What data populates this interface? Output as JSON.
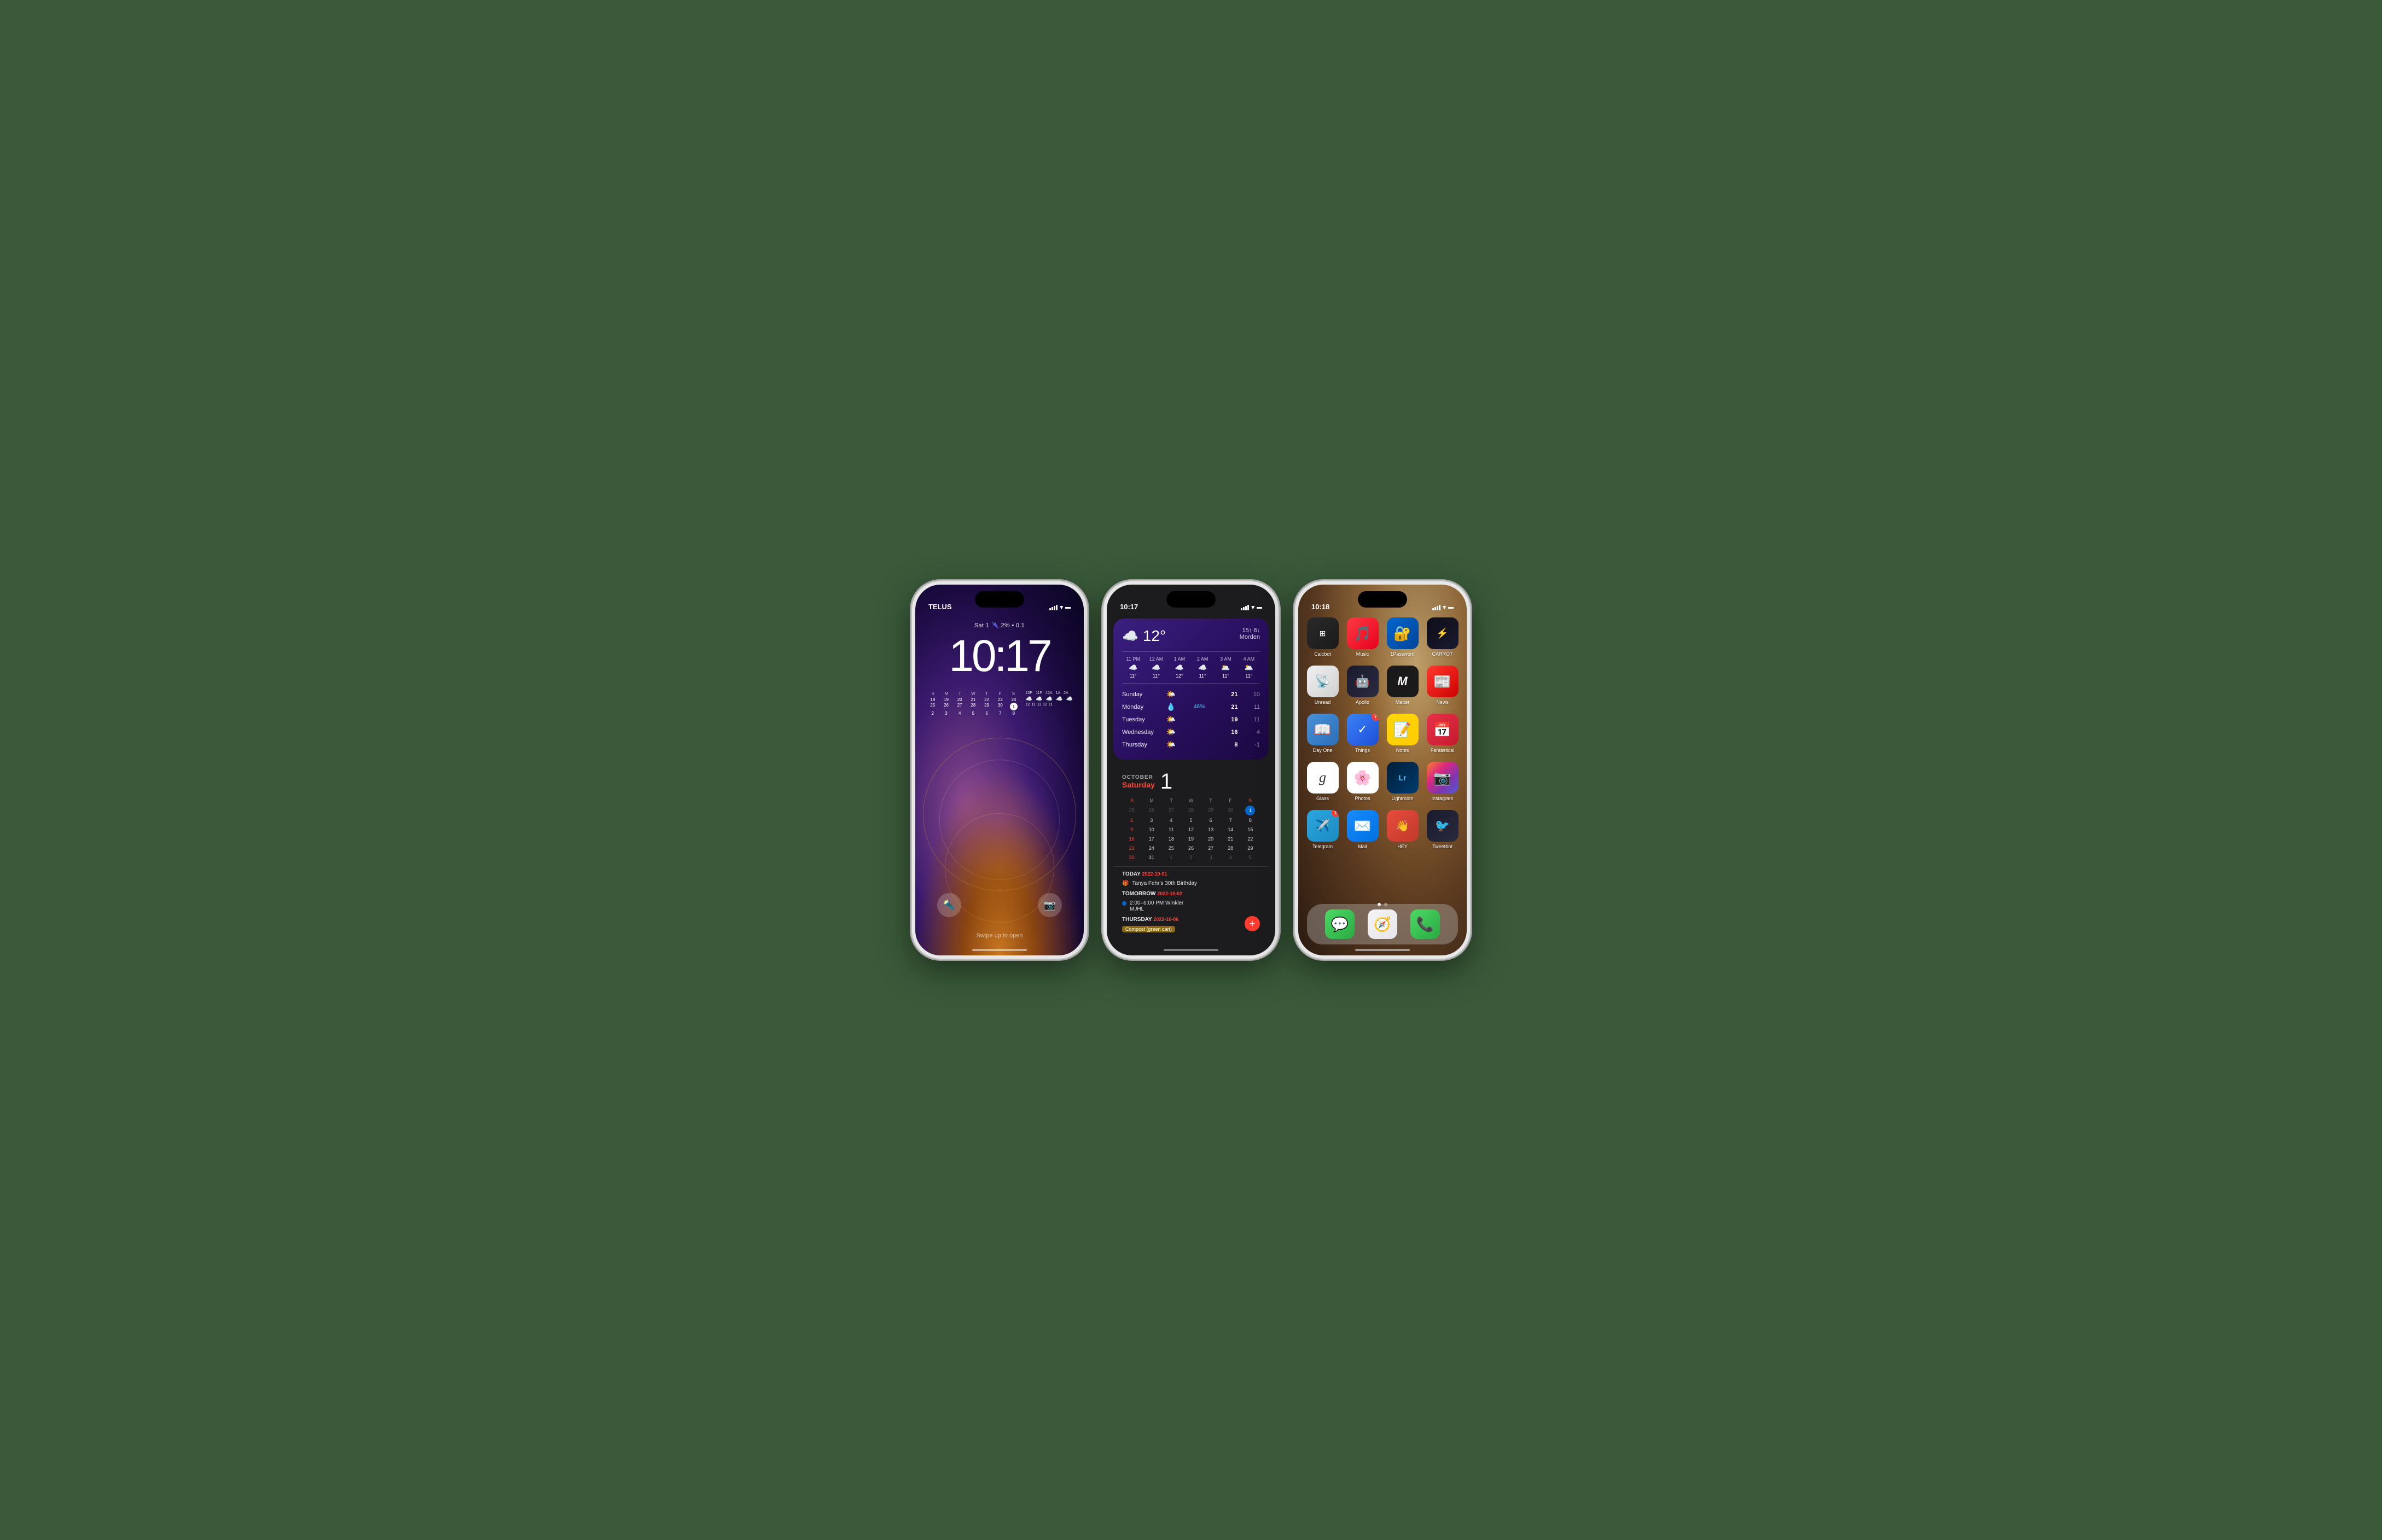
{
  "phones": {
    "phone1": {
      "type": "lock_screen",
      "carrier": "TELUS",
      "time": "10:17",
      "date": "Sat 1",
      "weather_summary": "🌂 2% • 0.1",
      "calendar": {
        "headers": [
          "S",
          "M",
          "T",
          "W",
          "T",
          "F",
          "S"
        ],
        "rows": [
          [
            "18",
            "19",
            "20",
            "21",
            "22",
            "23",
            "24"
          ],
          [
            "25",
            "26",
            "27",
            "28",
            "29",
            "30",
            "1"
          ],
          [
            "2",
            "3",
            "4",
            "5",
            "6",
            "7",
            "8"
          ]
        ]
      },
      "hourly_times": [
        "10P",
        "11P",
        "12A",
        "1A",
        "2A"
      ],
      "hourly_temps": [
        "12",
        "11",
        "11",
        "12",
        "11"
      ],
      "swipe_text": "Swipe up to open"
    },
    "phone2": {
      "type": "widgets",
      "carrier": "",
      "time": "10:17",
      "weather_widget": {
        "temp": "12°",
        "location": "Morden",
        "high": "15↑",
        "low": "8↓",
        "hourly": [
          {
            "time": "11 PM",
            "icon": "☁️",
            "temp": "11°"
          },
          {
            "time": "12 AM",
            "icon": "☁️",
            "temp": "11°"
          },
          {
            "time": "1 AM",
            "icon": "☁️",
            "temp": "12°"
          },
          {
            "time": "2 AM",
            "icon": "☁️",
            "temp": "11°"
          },
          {
            "time": "3 AM",
            "icon": "🌥️",
            "temp": "11°"
          },
          {
            "time": "4 AM",
            "icon": "🌥️",
            "temp": "11°"
          }
        ],
        "forecast": [
          {
            "day": "Sunday",
            "icon": "🌤️",
            "pct": "",
            "hi": "21",
            "lo": "10"
          },
          {
            "day": "Monday",
            "icon": "💧",
            "pct": "46%",
            "hi": "21",
            "lo": "11"
          },
          {
            "day": "Tuesday",
            "icon": "🌤️",
            "pct": "",
            "hi": "19",
            "lo": "11"
          },
          {
            "day": "Wednesday",
            "icon": "🌤️",
            "pct": "",
            "hi": "16",
            "lo": "4"
          },
          {
            "day": "Thursday",
            "icon": "🌤️",
            "pct": "",
            "hi": "8",
            "lo": "-1"
          }
        ]
      },
      "calendar_widget": {
        "month": "OCTOBER",
        "day_of_week": "Saturday",
        "today_num": "1",
        "headers": [
          "S",
          "M",
          "T",
          "W",
          "T",
          "F",
          "S"
        ],
        "weeks": [
          [
            "25",
            "26",
            "27",
            "28",
            "29",
            "30",
            "1"
          ],
          [
            "2",
            "3",
            "4",
            "5",
            "6",
            "7",
            "8"
          ],
          [
            "9",
            "10",
            "11",
            "12",
            "13",
            "14",
            "15"
          ],
          [
            "16",
            "17",
            "18",
            "19",
            "20",
            "21",
            "22"
          ],
          [
            "23",
            "24",
            "25",
            "26",
            "27",
            "28",
            "29"
          ],
          [
            "30",
            "31",
            "1",
            "2",
            "3",
            "4",
            "5"
          ]
        ],
        "events": [
          {
            "section": "TODAY",
            "date": "2022-10-01",
            "items": [
              {
                "icon": "🎁",
                "text": "Tanya Fehr's 30th Birthday"
              }
            ]
          },
          {
            "section": "TOMORROW",
            "date": "2022-10-02",
            "items": [
              {
                "type": "dot",
                "color": "#0066cc",
                "text": "2:00–6:00 PM Winkler"
              },
              {
                "type": "text",
                "text": "MJHL"
              }
            ]
          },
          {
            "section": "THURSDAY",
            "date": "2022-10-06",
            "items": [
              {
                "type": "tag",
                "color": "#8b6914",
                "text": "Compost (green cart)"
              }
            ]
          }
        ]
      }
    },
    "phone3": {
      "type": "home_screen",
      "carrier": "",
      "time": "10:18",
      "apps": [
        {
          "id": "calcbot",
          "label": "Calcbot",
          "icon_class": "icon-calcbot",
          "emoji": "⊞",
          "badge": null
        },
        {
          "id": "music",
          "label": "Music",
          "icon_class": "icon-music",
          "emoji": "🎵",
          "badge": null
        },
        {
          "id": "1password",
          "label": "1Password",
          "icon_class": "icon-1password",
          "emoji": "🔑",
          "badge": null
        },
        {
          "id": "carrot",
          "label": "CARROT",
          "icon_class": "icon-carrot",
          "emoji": "⚡",
          "badge": null
        },
        {
          "id": "unread",
          "label": "Unread",
          "icon_class": "icon-unread",
          "emoji": "📡",
          "badge": null
        },
        {
          "id": "apollo",
          "label": "Apollo",
          "icon_class": "icon-apollo",
          "emoji": "👾",
          "badge": null
        },
        {
          "id": "matter",
          "label": "Matter",
          "icon_class": "icon-matter",
          "emoji": "M",
          "badge": null
        },
        {
          "id": "news",
          "label": "News",
          "icon_class": "icon-news",
          "emoji": "📰",
          "badge": null
        },
        {
          "id": "dayone",
          "label": "Day One",
          "icon_class": "icon-dayone",
          "emoji": "📖",
          "badge": null
        },
        {
          "id": "things",
          "label": "Things",
          "icon_class": "icon-things",
          "emoji": "✓",
          "badge": "7"
        },
        {
          "id": "notes",
          "label": "Notes",
          "icon_class": "icon-notes",
          "emoji": "📝",
          "badge": null
        },
        {
          "id": "fantastical",
          "label": "Fantastical",
          "icon_class": "icon-fantastical",
          "emoji": "📅",
          "badge": null
        },
        {
          "id": "glass",
          "label": "Glass",
          "icon_class": "icon-glass",
          "emoji": "g",
          "badge": null
        },
        {
          "id": "photos",
          "label": "Photos",
          "icon_class": "icon-photos",
          "emoji": "🌸",
          "badge": null
        },
        {
          "id": "lightroom",
          "label": "Lightroom",
          "icon_class": "icon-lightroom",
          "emoji": "Lr",
          "badge": null
        },
        {
          "id": "instagram",
          "label": "Instagram",
          "icon_class": "icon-instagram",
          "emoji": "📷",
          "badge": null
        },
        {
          "id": "telegram",
          "label": "Telegram",
          "icon_class": "icon-telegram",
          "emoji": "✈️",
          "badge": "1"
        },
        {
          "id": "mail",
          "label": "Mail",
          "icon_class": "icon-mail",
          "emoji": "✉️",
          "badge": null
        },
        {
          "id": "hey",
          "label": "HEY",
          "icon_class": "icon-hey",
          "emoji": "👋",
          "badge": null
        },
        {
          "id": "tweetbot",
          "label": "Tweetbot",
          "icon_class": "icon-tweetbot",
          "emoji": "🐦",
          "badge": null
        }
      ],
      "dock": [
        {
          "id": "messages",
          "icon_class": "icon-messages",
          "emoji": "💬",
          "label": "Messages"
        },
        {
          "id": "safari",
          "icon_class": "icon-safari",
          "emoji": "🧭",
          "label": "Safari"
        },
        {
          "id": "phone",
          "icon_class": "icon-phone-app",
          "emoji": "📞",
          "label": "Phone"
        }
      ]
    }
  }
}
